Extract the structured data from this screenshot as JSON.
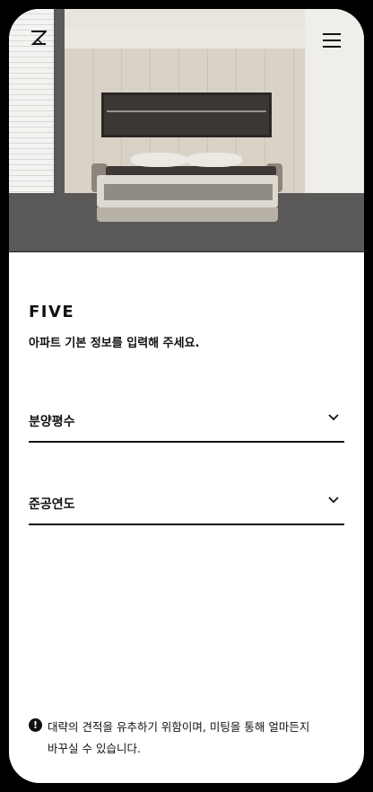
{
  "header": {
    "logo_icon": "z-logo-icon",
    "menu_icon": "hamburger-menu-icon"
  },
  "hero": {
    "image": "bedroom-interior-photo"
  },
  "content": {
    "brand": "FIVE",
    "subtitle": "아파트 기본 정보를 입력해 주세요."
  },
  "form": {
    "fields": [
      {
        "label": "분양평수",
        "icon": "chevron-down-icon"
      },
      {
        "label": "준공연도",
        "icon": "chevron-down-icon"
      }
    ]
  },
  "notice": {
    "icon": "exclamation-circle-icon",
    "line1": "대략의 견적을 유추하기 위함이며,  미팅을 통해 얼마든지",
    "line2": "바꾸실 수 있습니다."
  },
  "colors": {
    "text": "#111111",
    "background": "#ffffff",
    "frame": "#000000"
  }
}
